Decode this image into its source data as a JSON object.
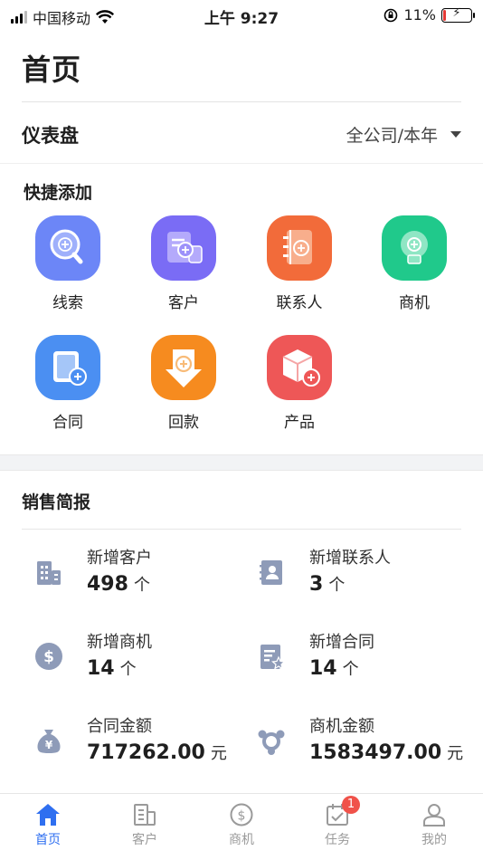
{
  "status": {
    "carrier": "中国移动",
    "time": "上午 9:27",
    "battery": "11%",
    "battery_level": 0.11
  },
  "page_title": "首页",
  "dashboard": {
    "label": "仪表盘",
    "scope": "全公司/本年"
  },
  "quick_add": {
    "title": "快捷添加",
    "items": [
      {
        "label": "线索",
        "icon": "search-plus-icon",
        "color": "#6c86f7"
      },
      {
        "label": "客户",
        "icon": "customer-card-icon",
        "color": "#7a6cf5"
      },
      {
        "label": "联系人",
        "icon": "contact-book-icon",
        "color": "#f26b3a"
      },
      {
        "label": "商机",
        "icon": "lightbulb-icon",
        "color": "#20c98b"
      },
      {
        "label": "合同",
        "icon": "contract-icon",
        "color": "#4b8ff2"
      },
      {
        "label": "回款",
        "icon": "download-payment-icon",
        "color": "#f68b1f"
      },
      {
        "label": "产品",
        "icon": "product-box-icon",
        "color": "#ee5757"
      }
    ]
  },
  "report": {
    "title": "销售简报",
    "stats": [
      {
        "label": "新增客户",
        "value": "498",
        "unit": "个",
        "icon": "building-icon"
      },
      {
        "label": "新增联系人",
        "value": "3",
        "unit": "个",
        "icon": "contact-card-icon"
      },
      {
        "label": "新增商机",
        "value": "14",
        "unit": "个",
        "icon": "dollar-circle-icon"
      },
      {
        "label": "新增合同",
        "value": "14",
        "unit": "个",
        "icon": "contract-star-icon"
      },
      {
        "label": "合同金额",
        "value": "717262.00",
        "unit": "元",
        "icon": "money-bag-icon"
      },
      {
        "label": "商机金额",
        "value": "1583497.00",
        "unit": "元",
        "icon": "network-icon"
      }
    ]
  },
  "tabs": [
    {
      "label": "首页",
      "icon": "home-icon",
      "active": true
    },
    {
      "label": "客户",
      "icon": "customer-icon",
      "active": false
    },
    {
      "label": "商机",
      "icon": "dollar-icon",
      "active": false
    },
    {
      "label": "任务",
      "icon": "task-icon",
      "active": false,
      "badge": "1"
    },
    {
      "label": "我的",
      "icon": "user-icon",
      "active": false
    }
  ],
  "colors": {
    "accent": "#2f6ff0",
    "stat_icon": "#8e9bb8",
    "badge": "#f0524a"
  }
}
